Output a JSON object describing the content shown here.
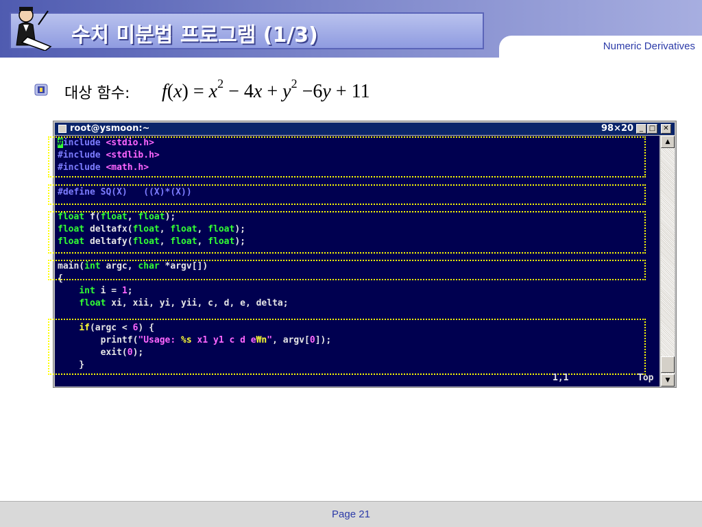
{
  "header": {
    "title": "수치 미분법 프로그램 (1/3)",
    "subtitle_tab": "Numeric Derivatives",
    "icon": "scholar-writing-icon"
  },
  "bullet": {
    "icon": "bullet-emblem-icon",
    "label": "대상 함수:",
    "formula": {
      "lhs_func": "f",
      "lhs_arg": "x",
      "equals": "=",
      "term1_var": "x",
      "term1_exp": "2",
      "op1": "−",
      "term2": "4",
      "term2_var": "x",
      "op2": "+",
      "term3_var": "y",
      "term3_exp": "2",
      "op3": "−",
      "term4": "6",
      "term4_var": "y",
      "op4": "+",
      "term5": "11"
    }
  },
  "terminal": {
    "title": "root@ysmoon:~",
    "size": "98×20",
    "buttons": {
      "minimize": "_",
      "maximize": "□",
      "close": "✕"
    },
    "colors": {
      "background": "#000050",
      "preprocessor": "#7d7dff",
      "string": "#ff66ff",
      "type": "#33ff33",
      "keyword": "#ffff33",
      "highlight_box": "#ffff00"
    },
    "lines": [
      [
        {
          "c": "t-cursor",
          "t": "#"
        },
        {
          "c": "t-pre",
          "t": "include "
        },
        {
          "c": "t-str",
          "t": "<stdio.h>"
        }
      ],
      [
        {
          "c": "t-pre",
          "t": "#include "
        },
        {
          "c": "t-str",
          "t": "<stdlib.h>"
        }
      ],
      [
        {
          "c": "t-pre",
          "t": "#include "
        },
        {
          "c": "t-str",
          "t": "<math.h>"
        }
      ],
      [
        {
          "c": "t-txt",
          "t": ""
        }
      ],
      [
        {
          "c": "t-pre",
          "t": "#define SQ(X)   ((X)*(X))"
        }
      ],
      [
        {
          "c": "t-txt",
          "t": ""
        }
      ],
      [
        {
          "c": "t-type",
          "t": "float"
        },
        {
          "c": "t-txt",
          "t": " f("
        },
        {
          "c": "t-type",
          "t": "float"
        },
        {
          "c": "t-txt",
          "t": ", "
        },
        {
          "c": "t-type",
          "t": "float"
        },
        {
          "c": "t-txt",
          "t": ");"
        }
      ],
      [
        {
          "c": "t-type",
          "t": "float"
        },
        {
          "c": "t-txt",
          "t": " deltafx("
        },
        {
          "c": "t-type",
          "t": "float"
        },
        {
          "c": "t-txt",
          "t": ", "
        },
        {
          "c": "t-type",
          "t": "float"
        },
        {
          "c": "t-txt",
          "t": ", "
        },
        {
          "c": "t-type",
          "t": "float"
        },
        {
          "c": "t-txt",
          "t": ");"
        }
      ],
      [
        {
          "c": "t-type",
          "t": "float"
        },
        {
          "c": "t-txt",
          "t": " deltafy("
        },
        {
          "c": "t-type",
          "t": "float"
        },
        {
          "c": "t-txt",
          "t": ", "
        },
        {
          "c": "t-type",
          "t": "float"
        },
        {
          "c": "t-txt",
          "t": ", "
        },
        {
          "c": "t-type",
          "t": "float"
        },
        {
          "c": "t-txt",
          "t": ");"
        }
      ],
      [
        {
          "c": "t-txt",
          "t": ""
        }
      ],
      [
        {
          "c": "t-txt",
          "t": "main("
        },
        {
          "c": "t-type",
          "t": "int"
        },
        {
          "c": "t-txt",
          "t": " argc, "
        },
        {
          "c": "t-type",
          "t": "char"
        },
        {
          "c": "t-txt",
          "t": " *argv[])"
        }
      ],
      [
        {
          "c": "t-txt",
          "t": "{"
        }
      ],
      [
        {
          "c": "t-txt",
          "t": "    "
        },
        {
          "c": "t-type",
          "t": "int"
        },
        {
          "c": "t-txt",
          "t": " i = "
        },
        {
          "c": "t-num",
          "t": "1"
        },
        {
          "c": "t-txt",
          "t": ";"
        }
      ],
      [
        {
          "c": "t-txt",
          "t": "    "
        },
        {
          "c": "t-type",
          "t": "float"
        },
        {
          "c": "t-txt",
          "t": " xi, xii, yi, yii, c, d, e, delta;"
        }
      ],
      [
        {
          "c": "t-txt",
          "t": ""
        }
      ],
      [
        {
          "c": "t-txt",
          "t": "    "
        },
        {
          "c": "t-kw",
          "t": "if"
        },
        {
          "c": "t-txt",
          "t": "(argc < "
        },
        {
          "c": "t-num",
          "t": "6"
        },
        {
          "c": "t-txt",
          "t": ") {"
        }
      ],
      [
        {
          "c": "t-txt",
          "t": "        printf("
        },
        {
          "c": "t-str",
          "t": "\"Usage: "
        },
        {
          "c": "t-kw",
          "t": "%s"
        },
        {
          "c": "t-str",
          "t": " x1 y1 c d e"
        },
        {
          "c": "t-kw",
          "t": "₩n"
        },
        {
          "c": "t-str",
          "t": "\""
        },
        {
          "c": "t-txt",
          "t": ", argv["
        },
        {
          "c": "t-num",
          "t": "0"
        },
        {
          "c": "t-txt",
          "t": "]);"
        }
      ],
      [
        {
          "c": "t-txt",
          "t": "        exit("
        },
        {
          "c": "t-num",
          "t": "0"
        },
        {
          "c": "t-txt",
          "t": ");"
        }
      ],
      [
        {
          "c": "t-txt",
          "t": "    }"
        }
      ]
    ],
    "status": {
      "position": "1,1",
      "scroll": "Top"
    }
  },
  "footer": {
    "page": "Page 21"
  }
}
